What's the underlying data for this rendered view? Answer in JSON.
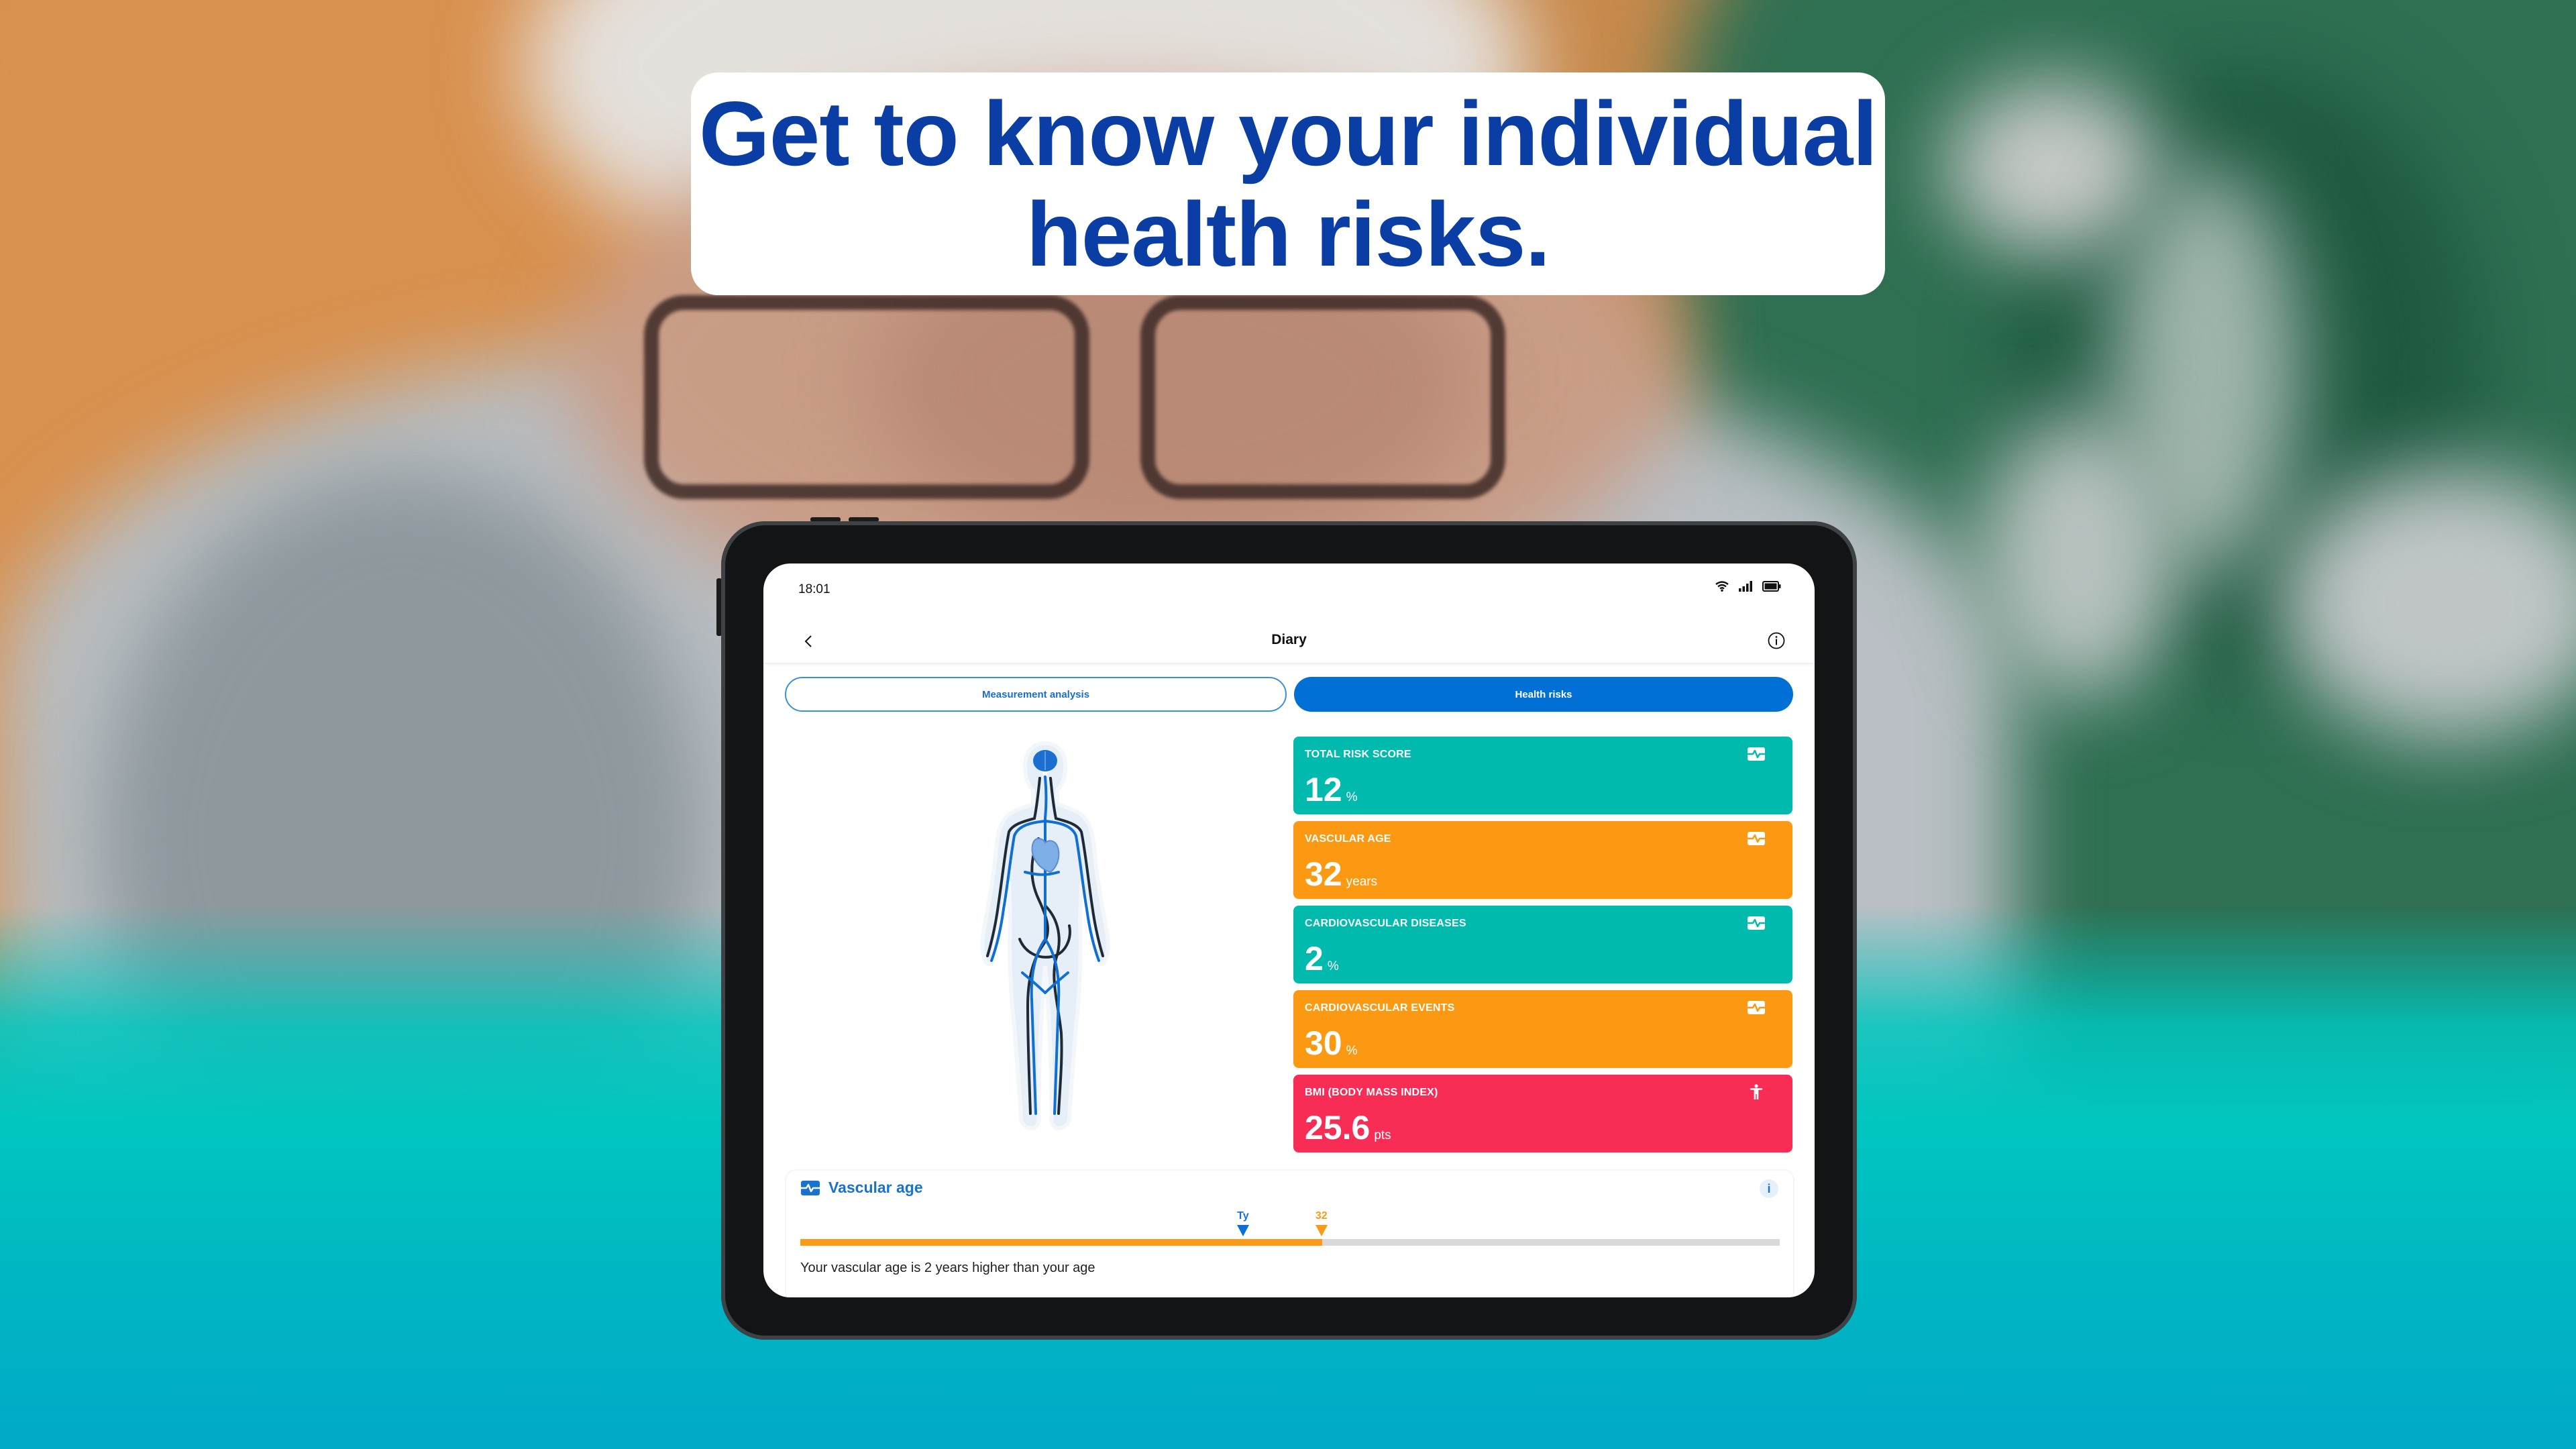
{
  "headline": {
    "line1": "Get to know your individual",
    "line2": "health risks."
  },
  "status_bar": {
    "time": "18:01",
    "icons": [
      "wifi-icon",
      "signal-icon",
      "battery-icon"
    ]
  },
  "header": {
    "title": "Diary",
    "back_icon": "chevron-left-icon",
    "info_icon": "info-icon"
  },
  "tabs": [
    {
      "label": "Measurement analysis",
      "active": false
    },
    {
      "label": "Health risks",
      "active": true
    }
  ],
  "risk_cards": [
    {
      "label": "TOTAL RISK  SCORE",
      "value": "12",
      "unit": "%",
      "color": "#00bbad",
      "icon": "heart-rate-icon"
    },
    {
      "label": "VASCULAR AGE",
      "value": "32",
      "unit": "years",
      "color": "#fb9a12",
      "icon": "heart-rate-icon"
    },
    {
      "label": "CARDIOVASCULAR DISEASES",
      "value": "2",
      "unit": "%",
      "color": "#00bbad",
      "icon": "heart-rate-icon"
    },
    {
      "label": "CARDIOVASCULAR EVENTS",
      "value": "30",
      "unit": "%",
      "color": "#fb9a12",
      "icon": "heart-rate-icon"
    },
    {
      "label": "BMI (BODY MASS INDEX)",
      "value": "25.6",
      "unit": "pts",
      "color": "#f72d55",
      "icon": "person-icon"
    }
  ],
  "vascular_age_panel": {
    "title": "Vascular age",
    "info_label": "i",
    "user_marker_label": "Ty",
    "vascular_marker_label": "32",
    "user_marker_fraction": 0.452,
    "vascular_marker_fraction": 0.532,
    "fill_fraction": 0.533,
    "description": "Your vascular age is 2 years higher than your age"
  },
  "colors": {
    "brand_blue": "#0070d6",
    "headline_blue": "#0a3ea5",
    "teal": "#00bbad",
    "orange": "#fb9a12",
    "red": "#f72d55"
  }
}
